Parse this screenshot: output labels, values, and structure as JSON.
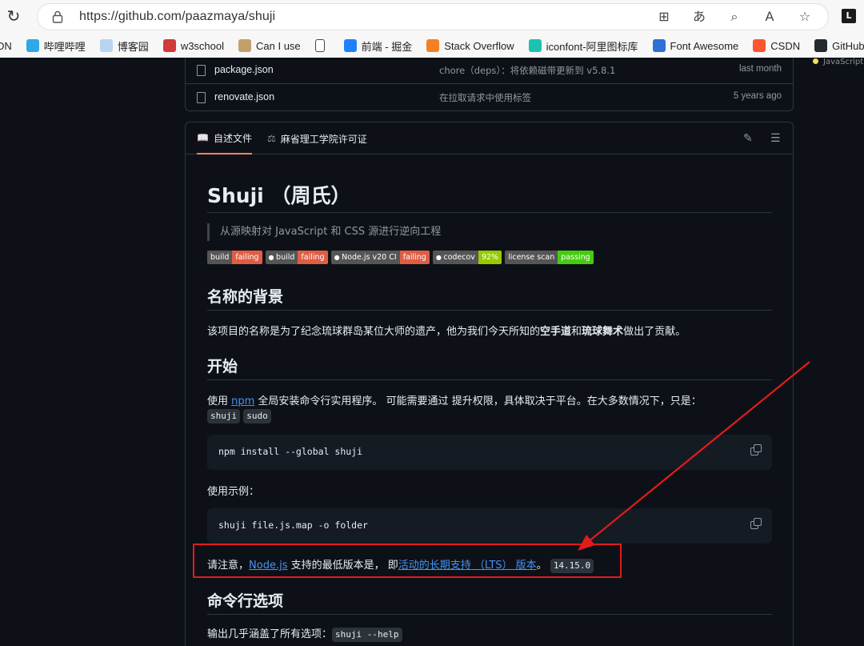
{
  "browser": {
    "url": "https://github.com/paazmaya/shuji",
    "ext_badge": "L",
    "bookmarks": [
      {
        "label": "DN",
        "icon": "none",
        "color": ""
      },
      {
        "label": "哔哩哔哩",
        "icon": "bilibili-icon",
        "color": "#2ea8e6"
      },
      {
        "label": "博客园",
        "icon": "cnblogs-icon",
        "color": "#b9d4ee"
      },
      {
        "label": "w3school",
        "icon": "w3school-icon",
        "color": "#d13a3a"
      },
      {
        "label": "Can I use",
        "icon": "caniuse-icon",
        "color": "#c2a06a"
      },
      {
        "label": "",
        "icon": "page-icon",
        "color": "#ffffff"
      },
      {
        "label": "前端 - 掘金",
        "icon": "juejin-icon",
        "color": "#1e80ff"
      },
      {
        "label": "Stack Overflow",
        "icon": "stackoverflow-icon",
        "color": "#f48024"
      },
      {
        "label": "iconfont-阿里图标库",
        "icon": "iconfont-icon",
        "color": "#1cc2b0"
      },
      {
        "label": "Font Awesome",
        "icon": "flag-icon",
        "color": "#2f6fd6"
      },
      {
        "label": "CSDN",
        "icon": "csdn-icon",
        "color": "#fc5531"
      },
      {
        "label": "GitHub",
        "icon": "github-icon",
        "color": "#24292f"
      }
    ]
  },
  "side_note": "JavaScript",
  "files": [
    {
      "name": "package.json",
      "message": "chore（deps）：将依赖磁带更新到 v5.8.1",
      "date": "last month"
    },
    {
      "name": "renovate.json",
      "message": "在拉取请求中使用标签",
      "date": "5 years ago"
    }
  ],
  "readme": {
    "tabs": [
      {
        "label": "自述文件",
        "icon": "book-icon"
      },
      {
        "label": "麻省理工学院许可证",
        "icon": "scale-icon"
      }
    ],
    "title": "Shuji （周氏）",
    "quote": "从源映射对 JavaScript 和 CSS 源进行逆向工程",
    "badges": [
      {
        "left": "build",
        "right": "failing",
        "color": "#e05d44",
        "icon": ""
      },
      {
        "left": "build",
        "right": "failing",
        "color": "#e05d44",
        "icon": "appveyor-icon"
      },
      {
        "left": "Node.js v20 CI",
        "right": "failing",
        "color": "#e05d44",
        "icon": "github-icon"
      },
      {
        "left": "codecov",
        "right": "92%",
        "color": "#97ca00",
        "icon": "codecov-icon"
      },
      {
        "left": "license scan",
        "right": "passing",
        "color": "#4c1",
        "icon": ""
      }
    ],
    "h2_background": "名称的背景",
    "bg_text_1": "该项目的名称是为了纪念琉球群岛某位大师的遗产，他为我们今天所知的",
    "bg_bold_1": "空手道",
    "bg_text_2": "和",
    "bg_bold_2": "琉球舞术",
    "bg_text_3": "做出了贡献。",
    "h2_start": "开始",
    "start_text_1": "使用 ",
    "start_link": "npm",
    "start_text_2": " 全局安装命令行实用程序。 可能需要通过 提升权限，具体取决于平台。在大多数情况下，只是：",
    "start_code_1": "shuji",
    "start_code_2": "sudo",
    "install_cmd": "npm install --global shuji",
    "usage_label": "使用示例：",
    "usage_cmd": "shuji file.js.map -o folder",
    "note_text_1": "请注意，",
    "note_link_1": "Node.js",
    "note_text_2": " 支持的最低版本是， 即",
    "note_link_2": "活动的长期支持 （LTS） 版本",
    "note_text_3": "。",
    "note_code": "14.15.0",
    "h2_cli": "命令行选项",
    "cli_text": "输出几乎涵盖了所有选项：",
    "cli_code": "shuji --help"
  },
  "annotation_color": "#e21b1b"
}
